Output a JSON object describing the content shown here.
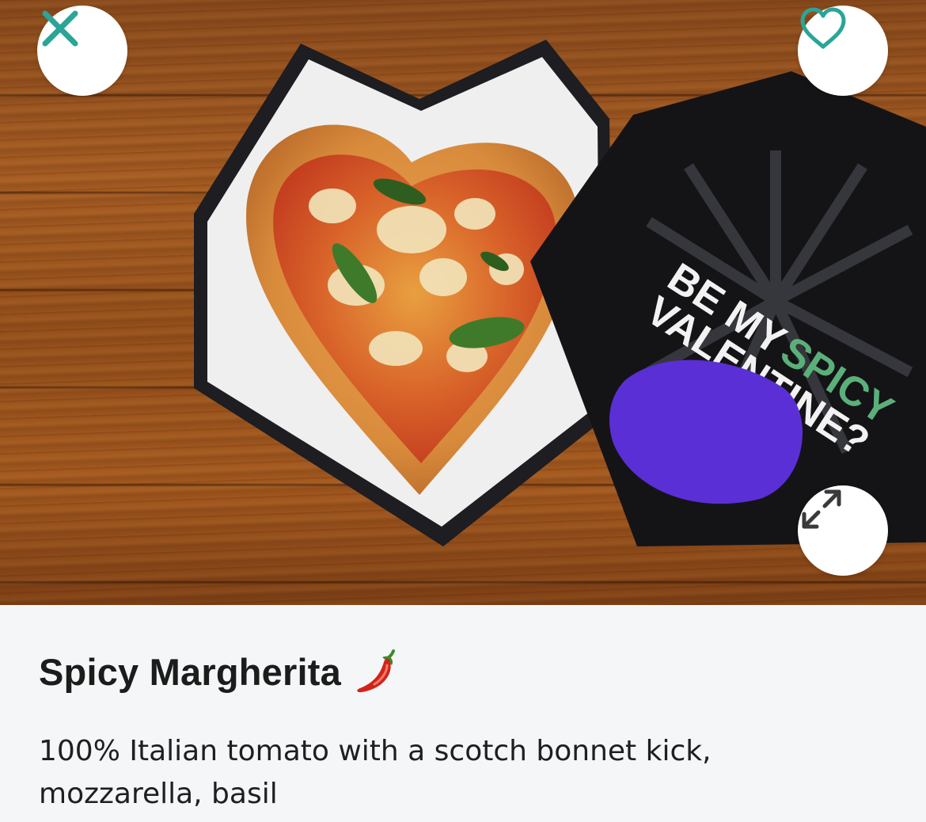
{
  "product": {
    "image": {
      "box_text_line1": "BE MY",
      "box_text_highlight": "SPICY",
      "box_text_line2": "VALENTINE?"
    },
    "title": "Spicy Margherita",
    "title_emoji_icon": "chili-pepper-icon",
    "description": "100% Italian tomato with a scotch bonnet kick, mozzarella, basil"
  },
  "controls": {
    "close_icon": "close-icon",
    "favorite_icon": "heart-icon",
    "expand_icon": "expand-icon"
  },
  "colors": {
    "accent": "#2aa597",
    "text": "#1c1c1c",
    "panel_background": "#f4f6f7"
  }
}
